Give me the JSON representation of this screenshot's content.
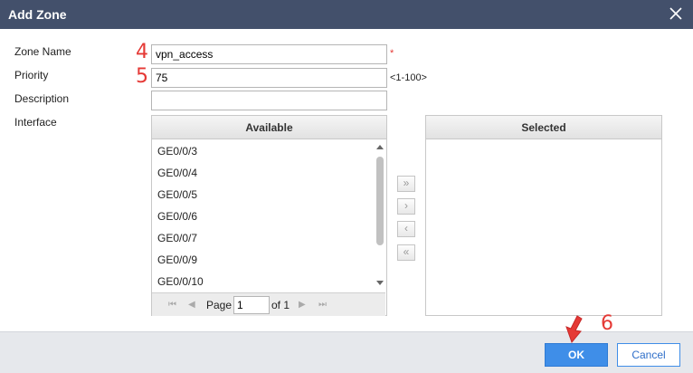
{
  "dialog": {
    "title": "Add Zone"
  },
  "form": {
    "zone_name": {
      "label": "Zone Name",
      "value": "vpn_access",
      "required_mark": "*"
    },
    "priority": {
      "label": "Priority",
      "value": "75",
      "hint": "<1-100>"
    },
    "description": {
      "label": "Description",
      "value": ""
    },
    "interface": {
      "label": "Interface"
    }
  },
  "annotations": {
    "step4": "4",
    "step5": "5",
    "step6": "6"
  },
  "available": {
    "header": "Available",
    "items": [
      "GE0/0/3",
      "GE0/0/4",
      "GE0/0/5",
      "GE0/0/6",
      "GE0/0/7",
      "GE0/0/9",
      "GE0/0/10"
    ],
    "pager": {
      "page_label": "Page",
      "current_page": "1",
      "of_label": "of 1"
    }
  },
  "selected": {
    "header": "Selected",
    "items": []
  },
  "move_buttons": {
    "add_all": "»",
    "add": "›",
    "remove": "‹",
    "remove_all": "«"
  },
  "footer": {
    "ok_label": "OK",
    "cancel_label": "Cancel"
  },
  "colors": {
    "titlebar": "#43506b",
    "ok_button": "#3f8ee8",
    "annotation": "#e53935"
  },
  "icons": {
    "close": "close-icon",
    "scroll_up": "scroll-up-arrow-icon",
    "scroll_down": "scroll-down-arrow-icon",
    "first_page": "first-page-icon",
    "prev_page": "prev-page-icon",
    "next_page": "next-page-icon",
    "last_page": "last-page-icon",
    "cursor": "cursor-arrow-icon"
  }
}
